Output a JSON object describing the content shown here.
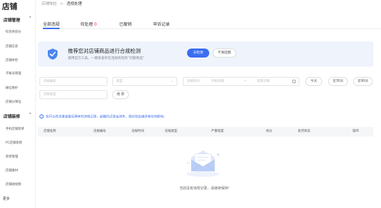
{
  "sidebar": {
    "brand": "店铺",
    "groups": [
      {
        "title": "店铺管理",
        "items": [
          "综合体验分",
          "店铺信息",
          "店铺体检",
          "子账号管理",
          "微信保护",
          "店铺分保证"
        ]
      },
      {
        "title": "店铺装修",
        "items": [
          "手机店铺装修",
          "PC店铺装修",
          "装修管理",
          "店铺素材",
          "店铺短视频"
        ]
      }
    ],
    "more": "更多"
  },
  "breadcrumb": {
    "parent": "店铺体检",
    "sep": ">",
    "current": "违规处理"
  },
  "tabs": [
    {
      "label": "全部违规"
    },
    {
      "label": "待处理",
      "count": "0"
    },
    {
      "label": "已撤销"
    },
    {
      "label": "申诉记录"
    }
  ],
  "banner": {
    "title": "推荐您对店铺商品进行合规检测",
    "subtitle": "使用官方工具，一键排查存在违规风险的“问题商品”",
    "primary_button": "去检测",
    "secondary_button": "不再提醒"
  },
  "filters": {
    "violation_no": "违规编号",
    "type": "类型",
    "date_start": "违规时间",
    "date_start_placeholder": "开始日期",
    "date_sep": "—",
    "date_end": "结束日期",
    "today": "今天",
    "last30": "近30天",
    "last90": "近90天",
    "violation_type": "违规类型",
    "search": "搜 索"
  },
  "notice": "您可以在这里查看近两年的违规记录，超期的记录会消失，但对您店铺没有任何影响。",
  "table": {
    "columns": [
      "店铺名称",
      "违规编号",
      "违规时间",
      "违规类型",
      "严重程度",
      "扣分",
      "处罚状态",
      "操作"
    ]
  },
  "empty_text": "当前没有违规记录，请继续保持!",
  "colors": {
    "accent": "#3a6df0",
    "danger": "#f5222d",
    "banner_bg": "#eef3fc"
  }
}
